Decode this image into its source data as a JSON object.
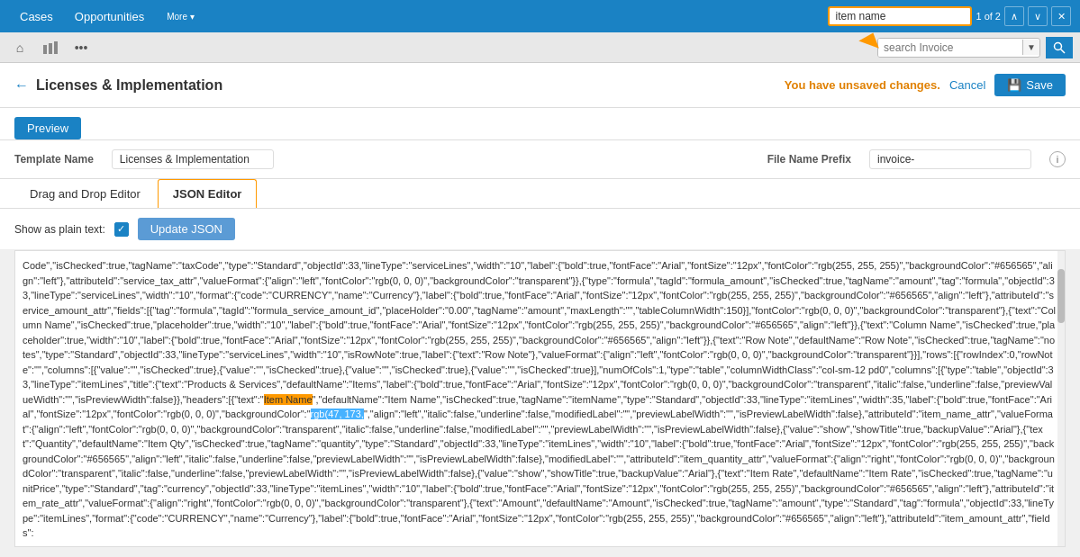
{
  "nav": {
    "items": [
      {
        "label": "Cases",
        "id": "cases"
      },
      {
        "label": "Opportunities",
        "id": "opportunities"
      },
      {
        "label": "More",
        "id": "more"
      }
    ],
    "search_value": "item name",
    "match_count": "1 of 2"
  },
  "toolbar2": {
    "home_icon": "⌂",
    "chart_icon": "📊",
    "more_icon": "•••",
    "search_placeholder": "search Invoice",
    "search_dropdown": "▼"
  },
  "page": {
    "back_label": "←",
    "title": "Licenses & Implementation",
    "unsaved_text": "You have unsaved changes.",
    "cancel_label": "Cancel",
    "save_label": "Save",
    "preview_label": "Preview"
  },
  "template": {
    "name_label": "Template Name",
    "name_value": "Licenses & Implementation",
    "prefix_label": "File Name Prefix",
    "prefix_value": "invoice-"
  },
  "editor": {
    "tabs": [
      {
        "label": "Drag and Drop Editor",
        "active": false
      },
      {
        "label": "JSON Editor",
        "active": true
      }
    ],
    "show_plain_label": "Show as plain text:",
    "update_btn": "Update JSON"
  },
  "json_content": "Code\",\"isChecked\":true,\"tagName\":\"taxCode\",\"type\":\"Standard\",\"objectId\":33,\"lineType\":\"serviceLines\",\"width\":\"10\",\"label\":{\"bold\":true,\"fontFace\":\"Arial\",\"fontSize\":\"12px\",\"fontColor\":\"rgb(255, 255, 255)\",\"backgroundColor\":\"#656565\",\"align\":\"left\"},\"attributeId\":\"service_tax_attr\",\"valueFormat\":{\"align\":\"left\",\"fontColor\":\"rgb(0, 0, 0)\",\"backgroundColor\":\"transparent\"}},{\"type\":\"formula\",\"tagId\":\"formula_amount\",\"isChecked\":true,\"tagName\":\"amount\",\"tag\":\"formula\",\"objectId\":33,\"lineType\":\"serviceLines\",\"width\":\"10\",\"format\":{\"code\":\"CURRENCY\",\"name\":\"Currency\"},\"label\":{\"bold\":true,\"fontFace\":\"Arial\",\"fontSize\":\"12px\",\"fontColor\":\"rgb(255, 255, 255)\",\"backgroundColor\":\"#656565\",\"align\":\"left\"},\"attributeId\":\"service_amount_attr\",\"fields\":[{\"tag\":\"formula\",\"tagId\":\"formula_service_amount_id\",\"placeHolder\":\"0.00\",\"tagName\":\"amount\",\"maxLength\":\"\",\"tableColumnWidth\":150}],\"fontColor\":\"rgb(0, 0, 0)\",\"backgroundColor\":\"transparent\"},{\"text\":\"Column Name\",\"isChecked\":true,\"placeholder\":true,\"width\":\"10\",\"label\":{\"bold\":true,\"fontFace\":\"Arial\",\"fontSize\":\"12px\",\"fontColor\":\"rgb(255, 255, 255)\",\"backgroundColor\":\"#656565\",\"align\":\"left\"}},{\"text\":\"Column Name\",\"isChecked\":true,\"placeholder\":true,\"width\":\"10\",\"label\":{\"bold\":true,\"fontFace\":\"Arial\",\"fontSize\":\"12px\",\"fontColor\":\"rgb(255, 255, 255)\",\"backgroundColor\":\"#656565\",\"align\":\"left\"}},{\"text\":\"Row Note\",\"defaultName\":\"Row\nNote\",\"isChecked\":true,\"tagName\":\"notes\",\"type\":\"Standard\",\"objectId\":33,\"lineType\":\"serviceLines\",\"width\":\"10\",\"isRowNote\":true,\"label\":{\"text\":\"Row Note\"},\"valueFormat\":{\"align\":\"left\",\"fontColor\":\"rgb(0, 0, 0)\",\"backgroundColor\":\"transparent\"}}],\"rows\":[{\"rowIndex\":0,\"rowNote\":\"\",\"columns\":[{\"value\":\"\",\"isChecked\":true},{\"value\":\"\",\"isChecked\":true},{\"value\":\"\",\"isChecked\":true},{\"value\":\"\",\"isChecked\":true}],\"numOfCols\":1,\"type\":\"table\",\"columnWidthClass\":\"col-sm-12 pd0\",\"columns\":[{\"type\":\"table\",\"objectId\":33,\"lineType\":\"itemLines\",\"title\":{\"text\":\"Products & Services\",\"defaultName\":\"Items\",\"label\":{\"bold\":true,\"fontFace\":\"Arial\",\"fontSize\":\"12px\",\"fontColor\":\"rgb(0, 0, 0)\",\"backgroundColor\":\"transparent\",\"italic\":false,\"underline\":false,\"previewValueWidth\":\"\",\"isPreviewWidth\":false}},\"headers\":[{\"text\":\"Item Name\",\"defaultName\":\"Item Name\",\"isChecked\":true,\"tagName\":\"itemName\",\"type\":\"Standard\",\"objectId\":33,\"lineType\":\"itemLines\",\"width\":35,\"label\":{\"bold\":true,\"fontFace\":\"Arial\",\"fontSize\":\"12px\",\"fontColor\":\"rgb(0, 0, 0)\",\"backgroundColor\":\"transparent\",\"italic\":false,\"underline\":false,\"modifiedLabel\":\"\",\"previewLabelWidth\":\"\",\"isPreviewLabelWidth\":false},\"attributeId\":\"item_name_attr\",\"valueFormat\":{\"align\":\"left\",\"fontColor\":\"rgb(0, 0, 0)\",\"backgroundColor\":\"transparent\",\"italic\":false,\"underline\":false,\"modifiedLabel\":\"\",\"previewLabelWidth\":\"\",\"isPreviewLabelWidth\":false},{\"value\":\"show\",\"showTitle\":true,\"backupValue\":\"Arial\"},{\"text\":\"Quantity\",\"defaultName\":\"Item Qty\",\"isChecked\":true,\"tagName\":\"quantity\",\"type\":\"Standard\",\"objectId\":33,\"lineType\":\"itemLines\",\"width\":\"10\",\"label\":{\"bold\":true,\"fontFace\":\"Arial\",\"fontSize\":\"12px\",\"fontColor\":\"rgb(255, 255, 255)\",\"backgroundColor\":\"#656565\",\"align\":\"left\",\"italic\":false,\"underline\":false,\"previewLabelWidth\":\"\",\"isPreviewLabelWidth\":false},\"modifiedLabel\":\"\",\"attributeId\":\"item_quantity_attr\",\"valueFormat\":{\"align\":\"right\",\"fontColor\":\"rgb(0, 0, 0)\",\"backgroundColor\":\"transparent\",\"italic\":false,\"underline\":false,\"previewLabelWidth\":\"\",\"isPreviewLabelWidth\":false},{\"value\":\"show\",\"showTitle\":true,\"backupValue\":\"Arial\"},{\"text\":\"Item Rate\",\"defaultName\":\"Item Rate\",\"isChecked\":true,\"tagName\":\"unitPrice\",\"type\":\"Standard\",\"tag\":\"currency\",\"objectId\":33,\"lineType\":\"itemLines\",\"width\":\"10\",\"label\":{\"bold\":true,\"fontFace\":\"Arial\",\"fontSize\":\"12px\",\"fontColor\":\"rgb(255, 255, 255)\",\"backgroundColor\":\"#656565\",\"align\":\"left\"},\"attributeId\":\"item_rate_attr\",\"valueFormat\":{\"align\":\"right\",\"fontColor\":\"rgb(0, 0, 0)\",\"backgroundColor\":\"transparent\"},{\"text\":\"Amount\",\"defaultName\":\"Amount\",\"isChecked\":true,\"tagName\":\"amount\",\"type\":\"Standard\",\"tag\":\"formula\",\"objectId\":33,\"lineType\":\"itemLines\",\"format\":{\"code\":\"CURRENCY\",\"name\":\"Currency\"},\"label\":{\"bold\":true,\"fontFace\":\"Arial\",\"fontSize\":\"12px\",\"fontColor\":\"rgb(255, 255, 255)\",\"backgroundColor\":\"#656565\",\"align\":\"left\"},\"attributeId\":\"item_amount_attr\",\"fields\":"
}
